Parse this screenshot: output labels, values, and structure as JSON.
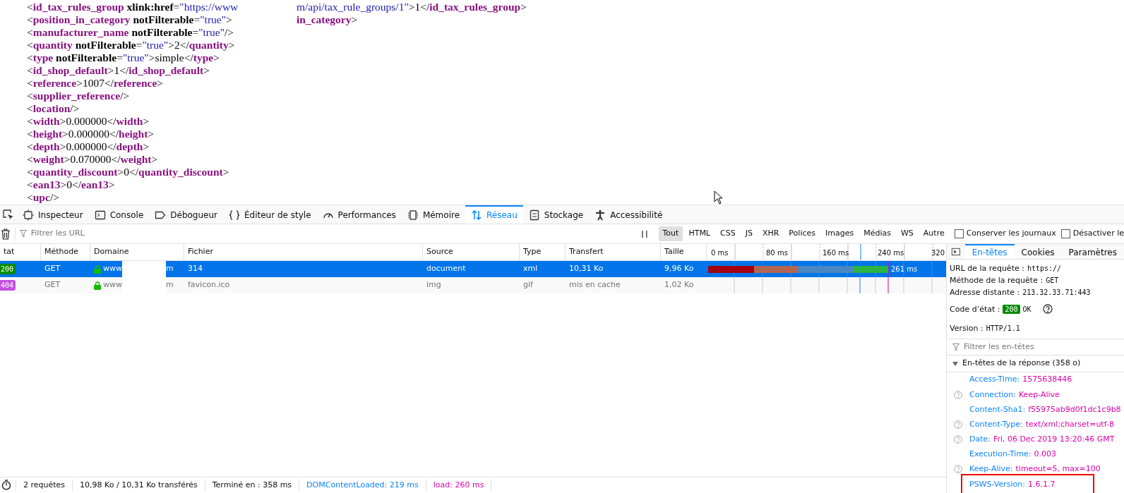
{
  "xml_lines": [
    {
      "left": [
        {
          "kind": "punct",
          "text": "<"
        },
        {
          "kind": "tag",
          "text": "id_tax_rules_group"
        },
        {
          "kind": "attr",
          "text": " xlink:href"
        },
        {
          "kind": "punct",
          "text": "="
        },
        {
          "kind": "value",
          "text": "\"https://www"
        }
      ],
      "right": [
        {
          "kind": "value",
          "text": "m/api/tax_rule_groups/1\""
        },
        {
          "kind": "punct",
          "text": ">1</"
        },
        {
          "kind": "tag",
          "text": "id_tax_rules_group"
        },
        {
          "kind": "punct",
          "text": ">"
        }
      ]
    },
    {
      "left": [
        {
          "kind": "punct",
          "text": "<"
        },
        {
          "kind": "tag",
          "text": "position_in_category"
        },
        {
          "kind": "attr",
          "text": " notFilterable"
        },
        {
          "kind": "punct",
          "text": "="
        },
        {
          "kind": "value",
          "text": "\"true\""
        },
        {
          "kind": "punct",
          "text": ">"
        }
      ],
      "right": [
        {
          "kind": "tag",
          "text": "in_category"
        },
        {
          "kind": "punct",
          "text": ">"
        }
      ]
    },
    {
      "left": [
        {
          "kind": "punct",
          "text": "<"
        },
        {
          "kind": "tag",
          "text": "manufacturer_name"
        },
        {
          "kind": "attr",
          "text": " notFilterable"
        },
        {
          "kind": "punct",
          "text": "="
        },
        {
          "kind": "value",
          "text": "\"true\""
        },
        {
          "kind": "punct",
          "text": "/>"
        }
      ]
    },
    {
      "left": [
        {
          "kind": "punct",
          "text": "<"
        },
        {
          "kind": "tag",
          "text": "quantity"
        },
        {
          "kind": "attr",
          "text": " notFilterable"
        },
        {
          "kind": "punct",
          "text": "="
        },
        {
          "kind": "value",
          "text": "\"true\""
        },
        {
          "kind": "punct",
          "text": ">2</"
        },
        {
          "kind": "tag",
          "text": "quantity"
        },
        {
          "kind": "punct",
          "text": ">"
        }
      ]
    },
    {
      "left": [
        {
          "kind": "punct",
          "text": "<"
        },
        {
          "kind": "tag",
          "text": "type"
        },
        {
          "kind": "attr",
          "text": " notFilterable"
        },
        {
          "kind": "punct",
          "text": "="
        },
        {
          "kind": "value",
          "text": "\"true\""
        },
        {
          "kind": "punct",
          "text": ">simple</"
        },
        {
          "kind": "tag",
          "text": "type"
        },
        {
          "kind": "punct",
          "text": ">"
        }
      ]
    },
    {
      "left": [
        {
          "kind": "punct",
          "text": "<"
        },
        {
          "kind": "tag",
          "text": "id_shop_default"
        },
        {
          "kind": "punct",
          "text": ">1</"
        },
        {
          "kind": "tag",
          "text": "id_shop_default"
        },
        {
          "kind": "punct",
          "text": ">"
        }
      ]
    },
    {
      "left": [
        {
          "kind": "punct",
          "text": "<"
        },
        {
          "kind": "tag",
          "text": "reference"
        },
        {
          "kind": "punct",
          "text": ">1007</"
        },
        {
          "kind": "tag",
          "text": "reference"
        },
        {
          "kind": "punct",
          "text": ">"
        }
      ]
    },
    {
      "left": [
        {
          "kind": "punct",
          "text": "<"
        },
        {
          "kind": "tag",
          "text": "supplier_reference"
        },
        {
          "kind": "punct",
          "text": "/>"
        }
      ]
    },
    {
      "left": [
        {
          "kind": "punct",
          "text": "<"
        },
        {
          "kind": "tag",
          "text": "location"
        },
        {
          "kind": "punct",
          "text": "/>"
        }
      ]
    },
    {
      "left": [
        {
          "kind": "punct",
          "text": "<"
        },
        {
          "kind": "tag",
          "text": "width"
        },
        {
          "kind": "punct",
          "text": ">0.000000</"
        },
        {
          "kind": "tag",
          "text": "width"
        },
        {
          "kind": "punct",
          "text": ">"
        }
      ]
    },
    {
      "left": [
        {
          "kind": "punct",
          "text": "<"
        },
        {
          "kind": "tag",
          "text": "height"
        },
        {
          "kind": "punct",
          "text": ">0.000000</"
        },
        {
          "kind": "tag",
          "text": "height"
        },
        {
          "kind": "punct",
          "text": ">"
        }
      ]
    },
    {
      "left": [
        {
          "kind": "punct",
          "text": "<"
        },
        {
          "kind": "tag",
          "text": "depth"
        },
        {
          "kind": "punct",
          "text": ">0.000000</"
        },
        {
          "kind": "tag",
          "text": "depth"
        },
        {
          "kind": "punct",
          "text": ">"
        }
      ]
    },
    {
      "left": [
        {
          "kind": "punct",
          "text": "<"
        },
        {
          "kind": "tag",
          "text": "weight"
        },
        {
          "kind": "punct",
          "text": ">0.070000</"
        },
        {
          "kind": "tag",
          "text": "weight"
        },
        {
          "kind": "punct",
          "text": ">"
        }
      ]
    },
    {
      "left": [
        {
          "kind": "punct",
          "text": "<"
        },
        {
          "kind": "tag",
          "text": "quantity_discount"
        },
        {
          "kind": "punct",
          "text": ">0</"
        },
        {
          "kind": "tag",
          "text": "quantity_discount"
        },
        {
          "kind": "punct",
          "text": ">"
        }
      ]
    },
    {
      "left": [
        {
          "kind": "punct",
          "text": "<"
        },
        {
          "kind": "tag",
          "text": "ean13"
        },
        {
          "kind": "punct",
          "text": ">0</"
        },
        {
          "kind": "tag",
          "text": "ean13"
        },
        {
          "kind": "punct",
          "text": ">"
        }
      ]
    },
    {
      "left": [
        {
          "kind": "punct",
          "text": "<"
        },
        {
          "kind": "tag",
          "text": "upc"
        },
        {
          "kind": "punct",
          "text": "/>"
        }
      ]
    }
  ],
  "tools": [
    {
      "label": "Inspecteur",
      "selected": false
    },
    {
      "label": "Console",
      "selected": false
    },
    {
      "label": "Débogueur",
      "selected": false
    },
    {
      "label": "Éditeur de style",
      "selected": false
    },
    {
      "label": "Performances",
      "selected": false
    },
    {
      "label": "Mémoire",
      "selected": false
    },
    {
      "label": "Réseau",
      "selected": true
    },
    {
      "label": "Stockage",
      "selected": false
    },
    {
      "label": "Accessibilité",
      "selected": false
    }
  ],
  "filter": {
    "placeholder": "Filtrer les URL"
  },
  "type_filters": [
    {
      "label": "Tout",
      "selected": true
    },
    {
      "label": "HTML",
      "selected": false
    },
    {
      "label": "CSS",
      "selected": false
    },
    {
      "label": "JS",
      "selected": false
    },
    {
      "label": "XHR",
      "selected": false
    },
    {
      "label": "Polices",
      "selected": false
    },
    {
      "label": "Images",
      "selected": false
    },
    {
      "label": "Médias",
      "selected": false
    },
    {
      "label": "WS",
      "selected": false
    },
    {
      "label": "Autre",
      "selected": false
    }
  ],
  "options": [
    {
      "label": "Conserver les journaux",
      "checked": false
    },
    {
      "label": "Désactiver le",
      "checked": false
    }
  ],
  "table": {
    "columns": [
      "tat",
      "Méthode",
      "Domaine",
      "Fichier",
      "Source",
      "Type",
      "Transfert",
      "Taille"
    ],
    "timeline_ticks": [
      "0 ms",
      "80 ms",
      "160 ms",
      "240 ms",
      "320"
    ],
    "rows": [
      {
        "status": "200",
        "color": "#058b00",
        "method": "GET",
        "domain_start": "www",
        "domain_end": "m",
        "file": "314",
        "source": "document",
        "type": "xml",
        "transfer": "10,31 Ko",
        "size": "9,96 Ko",
        "duration": "261 ms",
        "selected": true
      },
      {
        "status": "404",
        "color": "#c44fe0",
        "method": "GET",
        "domain_start": "www",
        "domain_end": "m",
        "file": "favicon.ico",
        "source": "img",
        "type": "gif",
        "transfer": "mis en cache",
        "size": "1,02 Ko",
        "selected": false
      }
    ]
  },
  "status_bar": [
    {
      "kind": "plain",
      "text": "2 requêtes"
    },
    {
      "kind": "plain",
      "text": "10,98 Ko / 10,31 Ko transférés"
    },
    {
      "kind": "plain",
      "text": "Terminé en : 358 ms"
    },
    {
      "kind": "dom",
      "text": "DOMContentLoaded: 219 ms"
    },
    {
      "kind": "load",
      "text": "load: 260 ms"
    }
  ],
  "details": {
    "tabs": [
      {
        "label": "En-têtes",
        "selected": true
      },
      {
        "label": "Cookies",
        "selected": false
      },
      {
        "label": "Paramètres",
        "selected": false
      }
    ],
    "summary": [
      {
        "label": "URL de la requête :",
        "value": "https://"
      },
      {
        "label": "Méthode de la requête :",
        "value": "GET"
      },
      {
        "label": "Adresse distante :",
        "value": "213.32.33.71:443"
      }
    ],
    "status_label": "Code d’état :",
    "status_code": "200",
    "status_text": "OK",
    "version_label": "Version :",
    "version": "HTTP/1.1",
    "filter": {
      "placeholder": "Filtrer les en-têtes"
    },
    "section": {
      "title": "En-têtes de la réponse (358 o)",
      "expanded": true
    },
    "headers": [
      {
        "name": "Access-Time:",
        "value": "1575638446",
        "help": false,
        "highlighted": false
      },
      {
        "name": "Connection:",
        "value": "Keep-Alive",
        "help": true,
        "highlighted": false
      },
      {
        "name": "Content-Sha1:",
        "value": "f55975ab9d0f1dc1c9b8",
        "help": false,
        "highlighted": false
      },
      {
        "name": "Content-Type:",
        "value": "text/xml;charset=utf-8",
        "help": true,
        "highlighted": false
      },
      {
        "name": "Date:",
        "value": "Fri, 06 Dec 2019 13:20:46 GMT",
        "help": true,
        "highlighted": false
      },
      {
        "name": "Execution-Time:",
        "value": "0.003",
        "help": false,
        "highlighted": false
      },
      {
        "name": "Keep-Alive:",
        "value": "timeout=5, max=100",
        "help": true,
        "highlighted": false
      },
      {
        "name": "PSWS-Version:",
        "value": "1.6.1.7",
        "help": false,
        "highlighted": true
      }
    ]
  }
}
